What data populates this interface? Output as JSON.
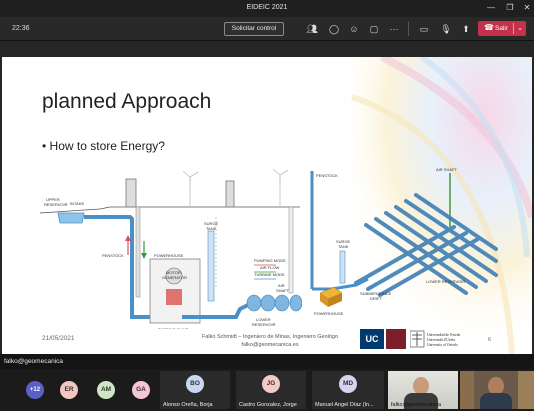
{
  "window": {
    "title": "EIDEIC 2021"
  },
  "toolbar": {
    "time": "22:36",
    "request_control_label": "Solicitar control",
    "leave_label": "Salir"
  },
  "slide": {
    "title": "planned Approach",
    "bullet": "How to store Energy?",
    "date": "21/05/2021",
    "footer_line1": "Falko Schmidt – Ingeniero de Minas, Ingeniero Geológo",
    "footer_line2": "falko@geomecanica.es",
    "page_number": "6",
    "logos": {
      "uc": "UC",
      "oviedo_text": "Universidad de Oviedo\nUniversidá d'Uviéu\nUniversity of Oviedo"
    },
    "diagram_left_labels": {
      "upper_reservoir": "UPPER\nRESERVOIR",
      "intake": "INTAKE",
      "penstock": "PENSTOCK",
      "powerhouse": "POWERHOUSE",
      "motor_generator": "MOTOR\nGENERATOR",
      "surge_tank": "SURGE\nTANK",
      "turbine_pump": "TURBINE-PUMP",
      "lower_reservoir": "LOWER\nRESERVOIR",
      "pumping_mode": "PUMPING MODE",
      "air_flow": "AIR FLOW",
      "turbine_mode": "TURBINE MODE",
      "air_shaft": "AIR\nSHAFT",
      "h_net": "H NET",
      "h_ground": "H GROUND_MAN"
    },
    "diagram_right_labels": {
      "penstock": "PENSTOCK",
      "air_shaft": "AIR SHAFT",
      "surge_tank": "SURGE\nTANK",
      "lower_reservoir": "LOWER RESERVOIR",
      "submergence_drift": "SUBMERGENCE\nDRIFT",
      "powerhouse": "POWERHOUSE"
    }
  },
  "presenter": {
    "label": "falko@geomecanica"
  },
  "participants": {
    "overflow_count": "+12",
    "avatars": [
      {
        "initials": "ER",
        "color": "#f3c6c0"
      },
      {
        "initials": "AM",
        "color": "#cfe6c6"
      },
      {
        "initials": "GA",
        "color": "#f5c7d4"
      }
    ],
    "named": [
      {
        "initials": "BO",
        "name": "Alonso Oreña, Borja",
        "color": "#c8d7f2"
      },
      {
        "initials": "JG",
        "name": "Castro Gonzalez, Jorge",
        "color": "#f4c9c9"
      },
      {
        "initials": "MD",
        "name": "Manuel Angel Díaz (In...",
        "color": "#d7d3ef"
      }
    ],
    "video_names": [
      "falko@geomecanica",
      ""
    ]
  },
  "colors": {
    "leave": "#c4314b",
    "pipe": "#4a90c8",
    "water": "#7fb7e0"
  }
}
